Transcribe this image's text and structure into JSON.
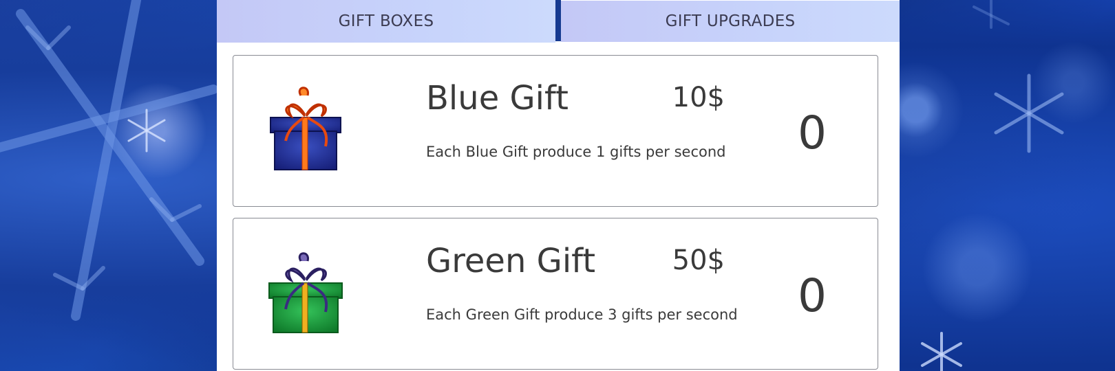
{
  "tabs": [
    {
      "label": "GIFT BOXES"
    },
    {
      "label": "GIFT UPGRADES"
    }
  ],
  "gifts": [
    {
      "name": "Blue Gift",
      "price": "10$",
      "description": "Each Blue Gift produce 1 gifts per second",
      "count": "0",
      "icon": "blue-gift-box-icon",
      "box_color": "#1f2f8f",
      "ribbon_color": "#ff6a1a"
    },
    {
      "name": "Green Gift",
      "price": "50$",
      "description": "Each Green Gift produce 3 gifts per second",
      "count": "0",
      "icon": "green-gift-box-icon",
      "box_color": "#1c9a3a",
      "ribbon_color": "#4a3b8a"
    }
  ],
  "colors": {
    "tab_background": "#c7d3fb",
    "background_blue": "#1848b0",
    "text": "#3a3a3a"
  }
}
